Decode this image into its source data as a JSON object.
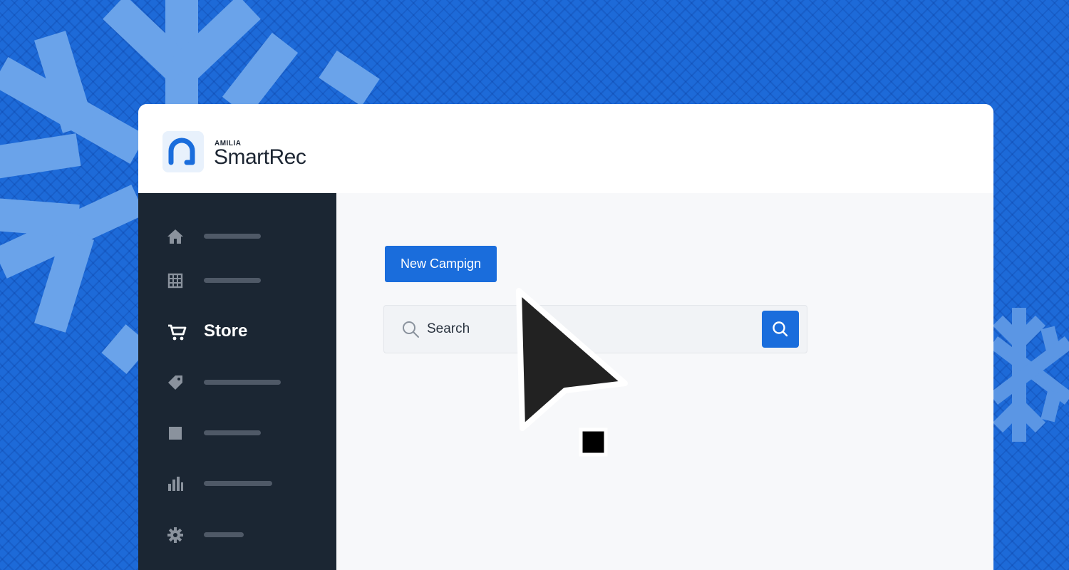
{
  "brand": {
    "overline": "AMILIA",
    "name": "SmartRec",
    "accent_color": "#1a6ddc"
  },
  "sidebar": {
    "items": [
      {
        "icon": "home-icon",
        "label": ""
      },
      {
        "icon": "grid-icon",
        "label": ""
      },
      {
        "icon": "cart-icon",
        "label": "Store",
        "active": true
      },
      {
        "icon": "tag-icon",
        "label": ""
      },
      {
        "icon": "square-icon",
        "label": ""
      },
      {
        "icon": "bar-chart-icon",
        "label": ""
      },
      {
        "icon": "gear-icon",
        "label": ""
      }
    ]
  },
  "main": {
    "new_campaign_label": "New Campign",
    "search": {
      "placeholder": "Search"
    }
  },
  "decor": {
    "background_icon": "snowflake-icon",
    "cursor_icon": "arrow-cursor-icon",
    "background_color": "#1d6ad8"
  }
}
